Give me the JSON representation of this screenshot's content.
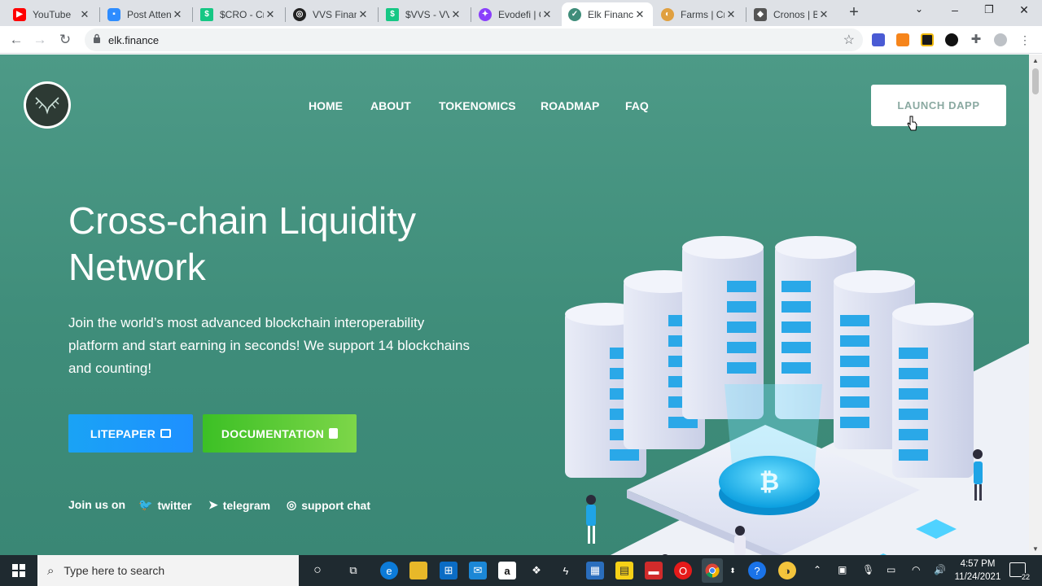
{
  "browser": {
    "tabs": [
      {
        "title": "YouTube",
        "icon": "youtube-icon",
        "color": "#ff0000"
      },
      {
        "title": "Post Atten",
        "icon": "zoom-icon",
        "color": "#2d8cff"
      },
      {
        "title": "$CRO - Cr",
        "icon": "chart-icon",
        "color": "#16c784"
      },
      {
        "title": "VVS Finan",
        "icon": "vvs-icon",
        "color": "#222222"
      },
      {
        "title": "$VVS - VV",
        "icon": "chart-icon",
        "color": "#16c784"
      },
      {
        "title": "Evodefi | C",
        "icon": "evodefi-icon",
        "color": "#8a3ffc"
      },
      {
        "title": "Elk Financ",
        "icon": "elk-icon",
        "color": "#3f8d7a"
      },
      {
        "title": "Farms | Cr",
        "icon": "farms-icon",
        "color": "#e0a040"
      },
      {
        "title": "Cronos | B",
        "icon": "cronos-icon",
        "color": "#555555"
      }
    ],
    "active_tab": 6,
    "url": "elk.finance"
  },
  "page": {
    "nav": [
      "HOME",
      "ABOUT",
      "TOKENOMICS",
      "ROADMAP",
      "FAQ"
    ],
    "launch_label": "LAUNCH DAPP",
    "headline": "Cross-chain Liquidity Network",
    "subtext": "Join the world’s most advanced blockchain interoperability platform and start earning in seconds! We support 14 blockchains and counting!",
    "litepaper_label": "LITEPAPER",
    "documentation_label": "DOCUMENTATION",
    "join_label": "Join us on",
    "social": [
      "twitter",
      "telegram",
      "support chat"
    ],
    "colors": {
      "background": "#438f7c",
      "litepaper": "#1e90ff",
      "documentation": "#5ccb36",
      "launch_text": "#8aa9a1"
    }
  },
  "taskbar": {
    "search_placeholder": "Type here to search",
    "time": "4:57 PM",
    "date": "11/24/2021",
    "notifications": "22"
  }
}
